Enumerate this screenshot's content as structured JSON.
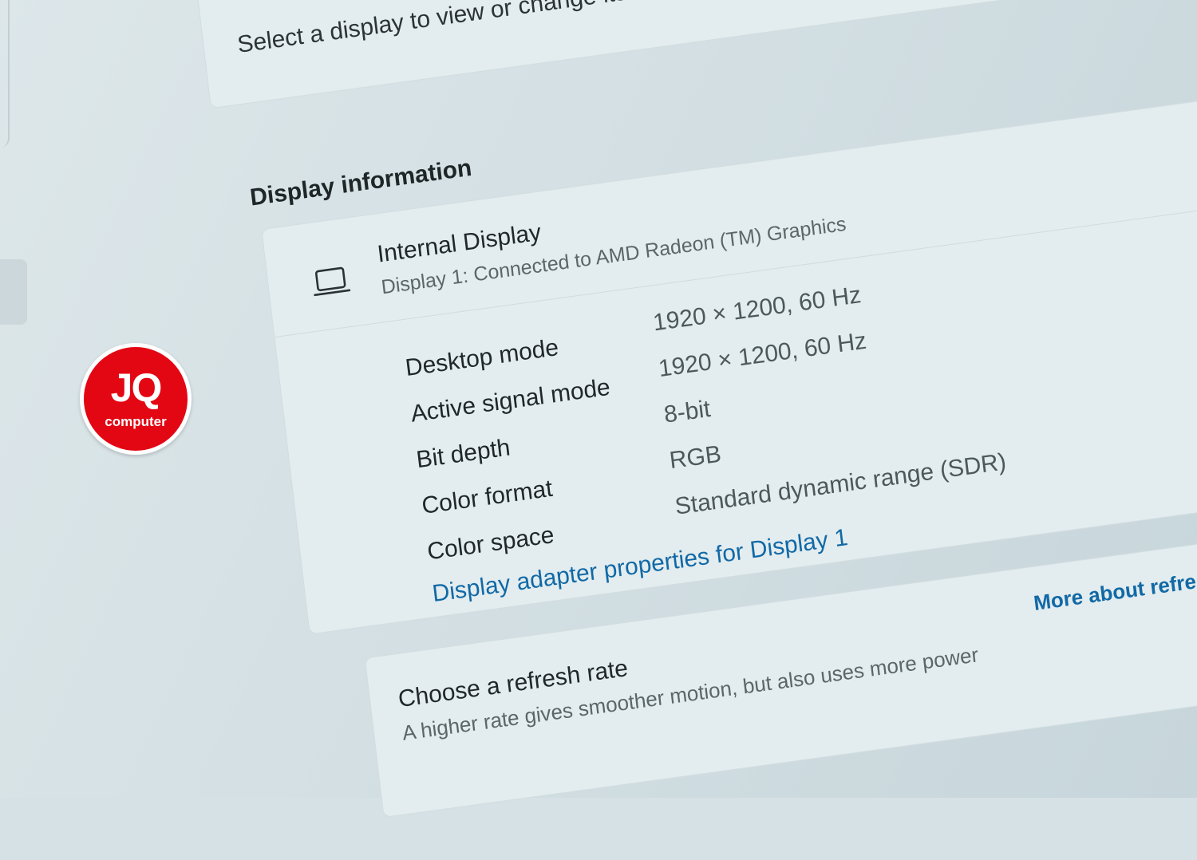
{
  "select_display": {
    "prompt": "Select a display to view or change its settings"
  },
  "display_information": {
    "title": "Display information",
    "display": {
      "icon": "laptop-icon",
      "name": "Internal Display",
      "subtitle": "Display 1: Connected to AMD Radeon (TM) Graphics"
    },
    "properties": [
      {
        "label": "Desktop mode",
        "value": "1920 × 1200, 60 Hz"
      },
      {
        "label": "Active signal mode",
        "value": "1920 × 1200, 60 Hz"
      },
      {
        "label": "Bit depth",
        "value": "8-bit"
      },
      {
        "label": "Color format",
        "value": "RGB"
      },
      {
        "label": "Color space",
        "value": "Standard dynamic range (SDR)"
      }
    ],
    "adapter_link": "Display adapter properties for Display 1"
  },
  "refresh_rate": {
    "title": "Choose a refresh rate",
    "description": "A higher rate gives smoother motion, but also uses more power",
    "link": "More about refresh rat"
  },
  "watermark": {
    "mark": "JQ",
    "sub": "computer"
  },
  "colors": {
    "accent_link": "#1169a6",
    "logo_red": "#e30613",
    "background": "#d5e1e4"
  }
}
